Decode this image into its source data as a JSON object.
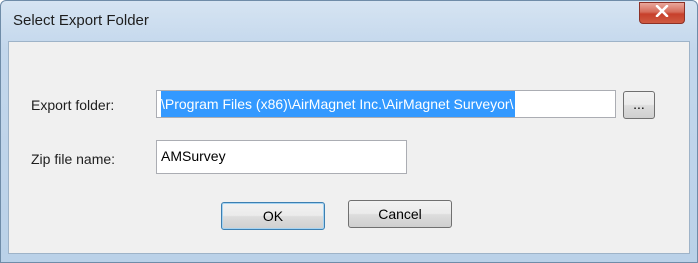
{
  "window": {
    "title": "Select Export Folder"
  },
  "form": {
    "export_folder_label": "Export folder:",
    "export_folder_value": "\\Program Files (x86)\\AirMagnet Inc.\\AirMagnet Surveyor\\",
    "browse_label": "...",
    "zip_label": "Zip file name:",
    "zip_value": "AMSurvey"
  },
  "buttons": {
    "ok_label": "OK",
    "cancel_label": "Cancel"
  },
  "icons": {
    "close": "close-icon"
  },
  "colors": {
    "selection": "#3399ff",
    "close_button": "#c7402b"
  }
}
